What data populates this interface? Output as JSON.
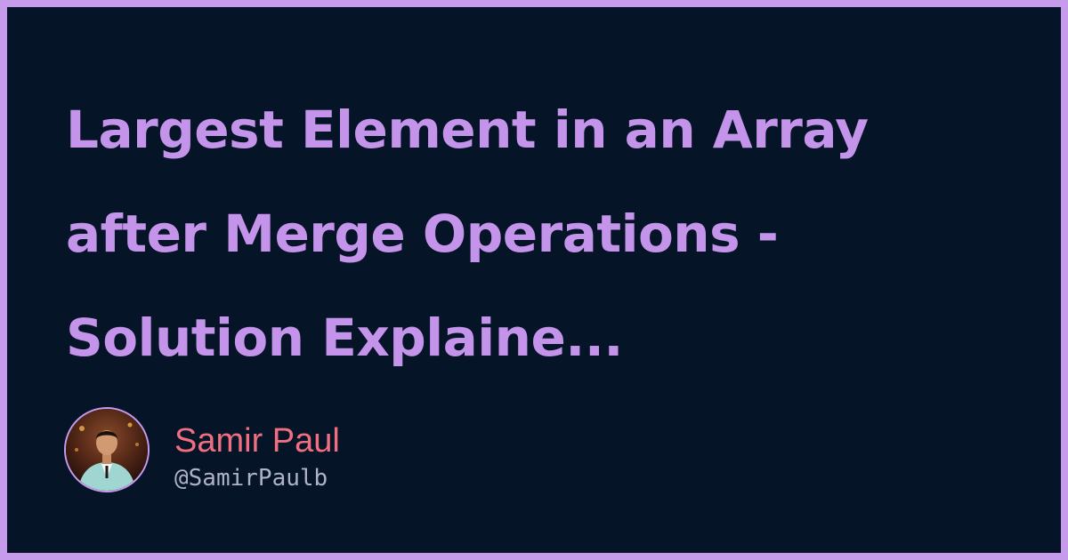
{
  "title": "Largest Element in an Array after Merge Operations - Solution Explaine...",
  "author": {
    "name": "Samir Paul",
    "handle": "@SamirPaulb",
    "avatar_icon": "author-avatar-photo"
  },
  "colors": {
    "border": "#c79bec",
    "background": "#061428",
    "title": "#c494ea",
    "name": "#ef6f80",
    "handle": "#aeb2c6"
  }
}
